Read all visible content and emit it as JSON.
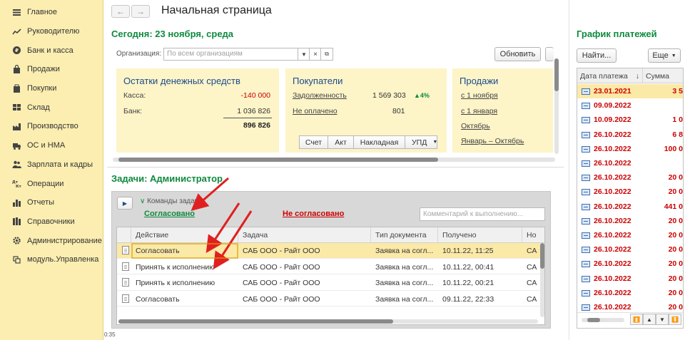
{
  "sidebar": {
    "items": [
      {
        "label": "Главное",
        "icon": "menu-icon"
      },
      {
        "label": "Руководителю",
        "icon": "chart-line-icon"
      },
      {
        "label": "Банк и касса",
        "icon": "coin-icon"
      },
      {
        "label": "Продажи",
        "icon": "shopping-bag-icon"
      },
      {
        "label": "Покупки",
        "icon": "cart-icon"
      },
      {
        "label": "Склад",
        "icon": "warehouse-icon"
      },
      {
        "label": "Производство",
        "icon": "factory-icon"
      },
      {
        "label": "ОС и НМА",
        "icon": "truck-icon"
      },
      {
        "label": "Зарплата и кадры",
        "icon": "people-icon"
      },
      {
        "label": "Операции",
        "icon": "debit-credit-icon"
      },
      {
        "label": "Отчеты",
        "icon": "bar-chart-icon"
      },
      {
        "label": "Справочники",
        "icon": "books-icon"
      },
      {
        "label": "Администрирование",
        "icon": "gear-icon"
      },
      {
        "label": "модуль.Управленка",
        "icon": "module-icon"
      }
    ],
    "timer": "0:35"
  },
  "header": {
    "title": "Начальная страница",
    "back": "←",
    "forward": "→"
  },
  "today": {
    "title": "Сегодня: 23 ноября, среда",
    "org_label": "Организация:",
    "org_placeholder": "По всем организациям",
    "refresh": "Обновить"
  },
  "cards": {
    "cash": {
      "title": "Остатки денежных средств",
      "rows": [
        {
          "label": "Касса:",
          "value": "-140 000"
        },
        {
          "label": "Банк:",
          "value": "1 036 826"
        }
      ],
      "total": "896 826"
    },
    "buyers": {
      "title": "Покупатели",
      "debt_label": "Задолженность",
      "debt_value": "1 569 303",
      "debt_change": "▲4%",
      "unpaid_label": "Не оплачено",
      "unpaid_value": "801",
      "buttons": [
        "Счет",
        "Акт",
        "Накладная",
        "УПД"
      ]
    },
    "sales": {
      "title": "Продажи",
      "links": [
        "с 1 ноября",
        "с 1 января",
        "Октябрь",
        "Январь – Октябрь"
      ]
    }
  },
  "tasks": {
    "title": "Задачи: Администратор",
    "commands_label": "Команды задачи",
    "approved": "Согласовано",
    "not_approved": "Не согласовано",
    "comment_placeholder": "Комментарий к выполнению...",
    "columns": [
      "Действие",
      "Задача",
      "Тип документа",
      "Получено",
      "Но"
    ],
    "rows": [
      {
        "action": "Согласовать",
        "task": "САБ ООО - Райт ООО",
        "doc_type": "Заявка на согл...",
        "received": "10.11.22, 11:25",
        "extra": "СА"
      },
      {
        "action": "Принять к исполнению",
        "task": "САБ ООО - Райт ООО",
        "doc_type": "Заявка на согл...",
        "received": "10.11.22, 00:41",
        "extra": "СА"
      },
      {
        "action": "Принять к исполнению",
        "task": "САБ ООО - Райт ООО",
        "doc_type": "Заявка на согл...",
        "received": "10.11.22, 00:21",
        "extra": "СА"
      },
      {
        "action": "Согласовать",
        "task": "САБ ООО - Райт ООО",
        "doc_type": "Заявка на согл...",
        "received": "09.11.22, 22:33",
        "extra": "СА"
      }
    ]
  },
  "payments": {
    "title": "График платежей",
    "find": "Найти...",
    "more": "Еще",
    "columns": [
      "Дата платежа",
      "Сумма"
    ],
    "rows": [
      {
        "date": "23.01.2021",
        "sum": "3 5"
      },
      {
        "date": "09.09.2022",
        "sum": ""
      },
      {
        "date": "10.09.2022",
        "sum": "1 0"
      },
      {
        "date": "26.10.2022",
        "sum": "6 8"
      },
      {
        "date": "26.10.2022",
        "sum": "100 0"
      },
      {
        "date": "26.10.2022",
        "sum": ""
      },
      {
        "date": "26.10.2022",
        "sum": "20 0"
      },
      {
        "date": "26.10.2022",
        "sum": "20 0"
      },
      {
        "date": "26.10.2022",
        "sum": "441 0"
      },
      {
        "date": "26.10.2022",
        "sum": "20 0"
      },
      {
        "date": "26.10.2022",
        "sum": "20 0"
      },
      {
        "date": "26.10.2022",
        "sum": "20 0"
      },
      {
        "date": "26.10.2022",
        "sum": "20 0"
      },
      {
        "date": "26.10.2022",
        "sum": "20 0"
      },
      {
        "date": "26.10.2022",
        "sum": "20 0"
      },
      {
        "date": "26.10.2022",
        "sum": "20 0"
      }
    ]
  },
  "colors": {
    "sidebar_bg": "#fbeeb0",
    "section_title": "#0e8a3e",
    "card_bg": "#fdf4c8",
    "link": "#1a4b8c",
    "negative": "#cc0000",
    "selected_row": "#fbe9a7",
    "annotation_arrow": "#e02020"
  }
}
